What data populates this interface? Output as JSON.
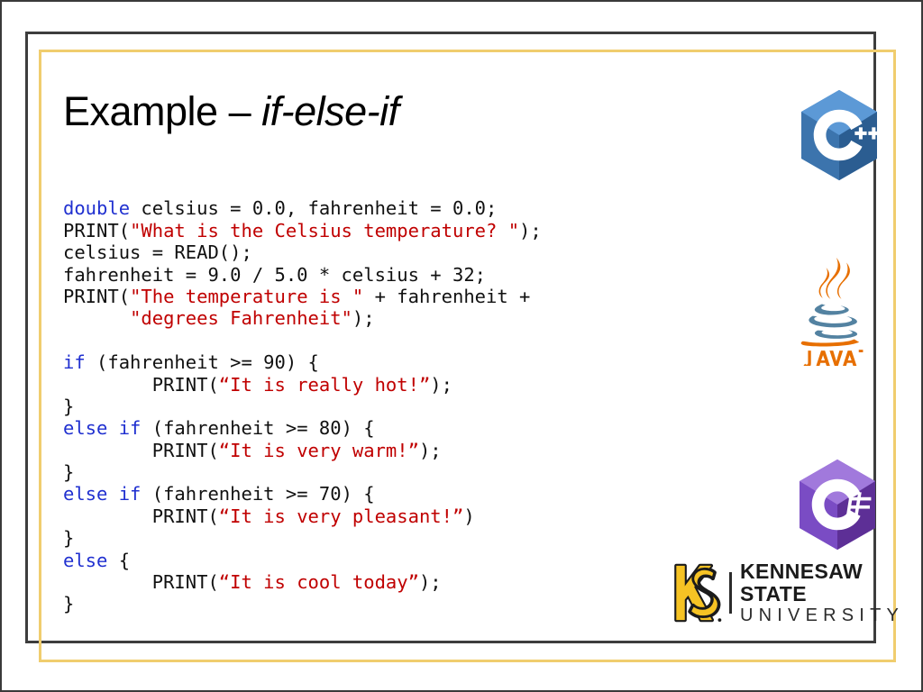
{
  "slide": {
    "title_main": "Example – ",
    "title_italic": "if-else-if",
    "background_color": "#ffffff",
    "frame_dark_color": "#3d3d3d",
    "frame_gold_color": "#f0cd6e"
  },
  "code": {
    "language_style": "pseudocode",
    "keyword_color": "#2030d0",
    "string_color": "#c00000",
    "plain_color": "#111111",
    "lines": [
      {
        "i": 0,
        "text": "double celsius = 0.0, fahrenheit = 0.0;"
      },
      {
        "i": 1,
        "text": "PRINT(\"What is the Celsius temperature? \");"
      },
      {
        "i": 2,
        "text": "celsius = READ();"
      },
      {
        "i": 3,
        "text": "fahrenheit = 9.0 / 5.0 * celsius + 32;"
      },
      {
        "i": 4,
        "text": "PRINT(\"The temperature is \" + fahrenheit +"
      },
      {
        "i": 5,
        "text": "      \"degrees Fahrenheit\");"
      },
      {
        "i": 6,
        "text": ""
      },
      {
        "i": 7,
        "text": "if (fahrenheit >= 90) {"
      },
      {
        "i": 8,
        "text": "        PRINT(“It is really hot!”);"
      },
      {
        "i": 9,
        "text": "}"
      },
      {
        "i": 10,
        "text": "else if (fahrenheit >= 80) {"
      },
      {
        "i": 11,
        "text": "        PRINT(“It is very warm!”);"
      },
      {
        "i": 12,
        "text": "}"
      },
      {
        "i": 13,
        "text": "else if (fahrenheit >= 70) {"
      },
      {
        "i": 14,
        "text": "        PRINT(“It is very pleasant!”)"
      },
      {
        "i": 15,
        "text": "}"
      },
      {
        "i": 16,
        "text": "else {"
      },
      {
        "i": 17,
        "text": "        PRINT(“It is cool today”);"
      },
      {
        "i": 18,
        "text": "}"
      }
    ],
    "tokens": {
      "kw_double": "double",
      "kw_if": "if",
      "kw_else": "else",
      "fn_print": "PRINT",
      "fn_read": "READ",
      "var_celsius": "celsius",
      "var_fahrenheit": "fahrenheit",
      "str_prompt": "\"What is the Celsius temperature? \"",
      "str_temp_is": "\"The temperature is \"",
      "str_degrees": "\"degrees Fahrenheit\"",
      "str_hot": "“It is really hot!”",
      "str_warm": "“It is very warm!”",
      "str_pleasant": "“It is very pleasant!”",
      "str_cool": "“It is cool today”",
      "num_zero": "0.0",
      "num_nine": "9.0",
      "num_five": "5.0",
      "num_32": "32",
      "num_90": "90",
      "num_80": "80",
      "num_70": "70"
    }
  },
  "logos": {
    "cpp": {
      "name": "cpp-logo",
      "label": "C",
      "suffix": "++",
      "hex_light": "#5c99d6",
      "hex_mid": "#4a86c4",
      "hex_dark": "#2b5d91"
    },
    "java": {
      "name": "java-logo",
      "wordmark": "Java",
      "steam_color": "#e76f00",
      "cup_color": "#5382a1",
      "text_color": "#e76f00"
    },
    "csharp": {
      "name": "csharp-logo",
      "label": "C",
      "suffix": "#",
      "hex_light": "#a179dc",
      "hex_mid": "#8a5cd0",
      "hex_dark": "#5d2f96"
    },
    "ksu": {
      "name": "kennesaw-state-university-logo",
      "line1": "KENNESAW STATE",
      "line2": "UNIVERSITY",
      "monogram": "KS",
      "gold": "#f6c324",
      "black": "#1b1b1b"
    }
  }
}
